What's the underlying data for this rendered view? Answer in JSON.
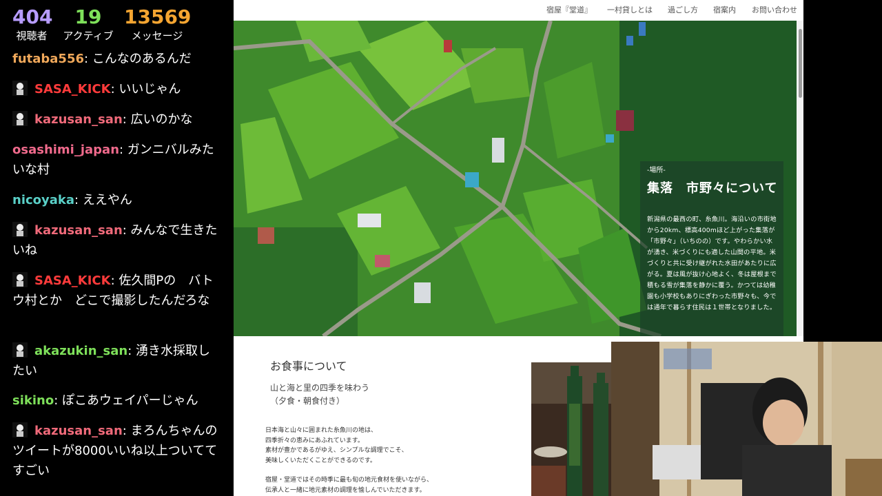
{
  "stats": [
    {
      "value": "404",
      "label": "視聴者",
      "color": "#b79cff"
    },
    {
      "value": "19",
      "label": "アクティブ",
      "color": "#7ee05a"
    },
    {
      "value": "13569",
      "label": "メッセージ",
      "color": "#f5a531"
    }
  ],
  "chat": [
    {
      "user": "futaba556",
      "text": ": こんなのあるんだ",
      "color": "#f0a85a",
      "avatar": false
    },
    {
      "user": "SASA_KICK",
      "text": ": いいじゃん",
      "color": "#ff3b3b",
      "avatar": true
    },
    {
      "user": "kazusan_san",
      "text": ": 広いのかな",
      "color": "#f06a7a",
      "avatar": true
    },
    {
      "user": "osashimi_japan",
      "text": ": ガンニバルみたいな村",
      "color": "#f06a8c",
      "avatar": false
    },
    {
      "user": "nicoyaka",
      "text": ": ええやん",
      "color": "#5ad0c8",
      "avatar": false
    },
    {
      "user": "kazusan_san",
      "text": ": みんなで生きたいね",
      "color": "#f06a7a",
      "avatar": true
    },
    {
      "user": "SASA_KICK",
      "text": ": 佐久間Pの　バトウ村とか　どこで撮影したんだろな",
      "color": "#ff3b3b",
      "avatar": true
    },
    {
      "user": "akazukin_san",
      "text": ": 湧き水採取したい",
      "color": "#7ee05a",
      "avatar": true
    },
    {
      "user": "sikino",
      "text": ": ぽこあウェイパーじゃん",
      "color": "#7ee05a",
      "avatar": false
    },
    {
      "user": "kazusan_san",
      "text": ": まろんちゃんのツイートが8000いいね以上ついててすごい",
      "color": "#f06a7a",
      "avatar": true
    }
  ],
  "nav": [
    "宿屋『堂道』",
    "一村貸しとは",
    "過ごし方",
    "宿案内",
    "お問い合わせ"
  ],
  "info": {
    "tag": "-場所-",
    "title": "集落　市野々について",
    "text": "新潟県の最西の町、糸魚川。海沿いの市街地から20km、標高400mほど上がった集落が「市野々」（いちのの）です。やわらかい水が湧き、米づくりにも適した山間の平地。米づくりと共に受け継がれた水田があたりに広がる。夏は風が抜け心地よく、冬は屋根まで積もる雪が集落を静かに覆う。かつては幼稚園も小学校もありにぎわった市野々も、今では通年で暮らす住民は１世帯となりました。"
  },
  "food": {
    "title": "お食事について",
    "subtitle": "山と海と里の四季を味わう",
    "subtitle2": "（夕食・朝食付き）",
    "body1": "日本海と山々に囲まれた糸魚川の地は、",
    "body2": "四季折々の恵みにあふれています。",
    "body3": "素材が豊かであるがゆえ、シンプルな調理でこそ、",
    "body4": "美味しくいただくことができるのです。",
    "body5": "宿屋・堂道ではその時季に最も旬の地元食材を使いながら、",
    "body6": "伝承人と一緒に地元素材の調理を愉しんでいただきます。"
  }
}
